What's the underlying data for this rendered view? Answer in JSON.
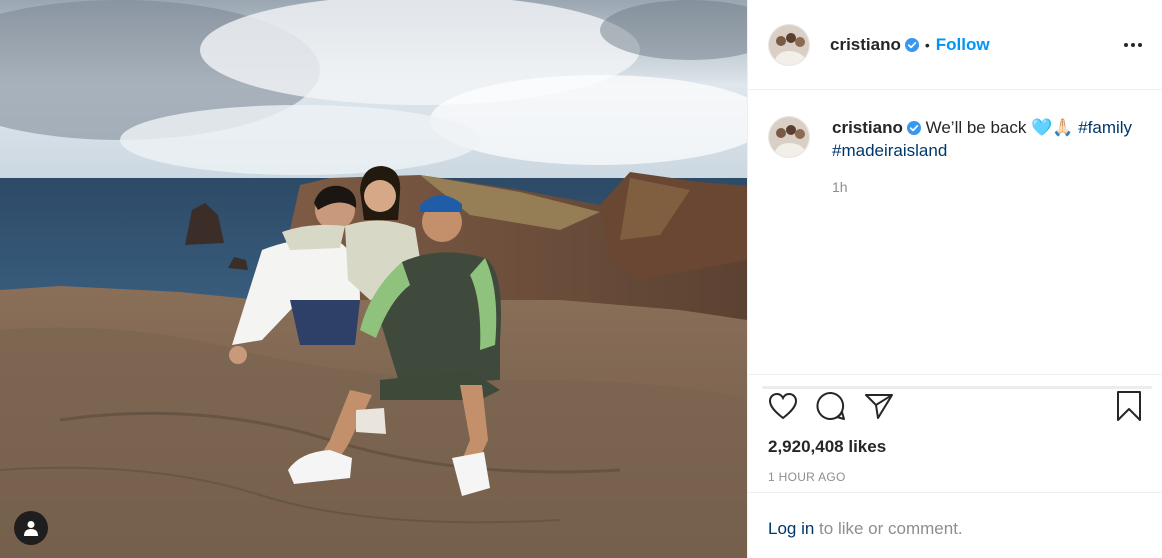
{
  "post": {
    "author": "cristiano",
    "follow_label": "Follow",
    "separator": "•",
    "caption": {
      "username": "cristiano",
      "text": "We’ll be back",
      "emoji": "🩵🙏🏻",
      "hashtags": [
        "#family",
        "#madeiraisland"
      ],
      "time": "1h"
    },
    "likes": "2,920,408 likes",
    "posted_ago": "1 HOUR AGO",
    "login": {
      "link_label": "Log in",
      "rest": " to like or comment."
    }
  },
  "icons": {
    "verified": "verified-badge-icon",
    "more": "more-options-icon",
    "like": "heart-icon",
    "comment": "comment-icon",
    "share": "paper-plane-icon",
    "save": "bookmark-icon",
    "user_tag": "user-tag-icon"
  },
  "colors": {
    "follow": "#0095f6",
    "hashtag": "#00376b",
    "verified": "#3897f0",
    "muted": "#8e8e8e"
  }
}
